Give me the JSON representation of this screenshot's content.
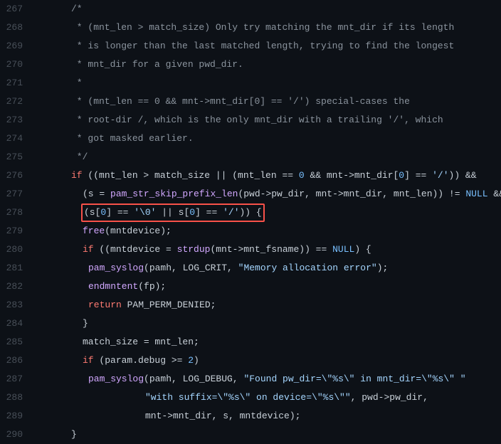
{
  "lines": [
    {
      "num": "267",
      "cls": "indent1",
      "segs": [
        {
          "c": "c-comment",
          "t": "/*"
        }
      ]
    },
    {
      "num": "268",
      "cls": "indent1",
      "segs": [
        {
          "c": "c-comment",
          "t": " * (mnt_len > match_size) Only try matching the mnt_dir if its length"
        }
      ]
    },
    {
      "num": "269",
      "cls": "indent1",
      "segs": [
        {
          "c": "c-comment",
          "t": " * is longer than the last matched length, trying to find the longest"
        }
      ]
    },
    {
      "num": "270",
      "cls": "indent1",
      "segs": [
        {
          "c": "c-comment",
          "t": " * mnt_dir for a given pwd_dir."
        }
      ]
    },
    {
      "num": "271",
      "cls": "indent1",
      "segs": [
        {
          "c": "c-comment",
          "t": " *"
        }
      ]
    },
    {
      "num": "272",
      "cls": "indent1",
      "segs": [
        {
          "c": "c-comment",
          "t": " * (mnt_len == 0 && mnt->mnt_dir[0] == '/') special-cases the"
        }
      ]
    },
    {
      "num": "273",
      "cls": "indent1",
      "segs": [
        {
          "c": "c-comment",
          "t": " * root-dir /, which is the only mnt_dir with a trailing '/', which"
        }
      ]
    },
    {
      "num": "274",
      "cls": "indent1",
      "segs": [
        {
          "c": "c-comment",
          "t": " * got masked earlier."
        }
      ]
    },
    {
      "num": "275",
      "cls": "indent1",
      "segs": [
        {
          "c": "c-comment",
          "t": " */"
        }
      ]
    },
    {
      "num": "276",
      "cls": "indent1",
      "segs": [
        {
          "c": "c-kw",
          "t": "if"
        },
        {
          "c": "c-default",
          "t": " ((mnt_len > match_size || (mnt_len == "
        },
        {
          "c": "c-num",
          "t": "0"
        },
        {
          "c": "c-default",
          "t": " && mnt->mnt_dir["
        },
        {
          "c": "c-num",
          "t": "0"
        },
        {
          "c": "c-default",
          "t": "] == "
        },
        {
          "c": "c-str",
          "t": "'/'"
        },
        {
          "c": "c-default",
          "t": ")) &&"
        }
      ]
    },
    {
      "num": "277",
      "cls": "indent2b",
      "segs": [
        {
          "c": "c-default",
          "t": "(s = "
        },
        {
          "c": "c-fn",
          "t": "pam_str_skip_prefix_len"
        },
        {
          "c": "c-default",
          "t": "(pwd->pw_dir, mnt->mnt_dir, mnt_len)) != "
        },
        {
          "c": "c-const",
          "t": "NULL"
        },
        {
          "c": "c-default",
          "t": " &&"
        }
      ]
    },
    {
      "num": "278",
      "cls": "indent2b",
      "hl": true,
      "segs": [
        {
          "c": "c-default",
          "t": "(s["
        },
        {
          "c": "c-num",
          "t": "0"
        },
        {
          "c": "c-default",
          "t": "] == "
        },
        {
          "c": "c-str",
          "t": "'\\0'"
        },
        {
          "c": "c-default",
          "t": " || s["
        },
        {
          "c": "c-num",
          "t": "0"
        },
        {
          "c": "c-default",
          "t": "] == "
        },
        {
          "c": "c-str",
          "t": "'/'"
        },
        {
          "c": "c-default",
          "t": ")) {"
        }
      ]
    },
    {
      "num": "279",
      "cls": "indent2b",
      "segs": [
        {
          "c": "c-fn",
          "t": "free"
        },
        {
          "c": "c-default",
          "t": "(mntdevice);"
        }
      ]
    },
    {
      "num": "280",
      "cls": "indent2b",
      "segs": [
        {
          "c": "c-kw",
          "t": "if"
        },
        {
          "c": "c-default",
          "t": " ((mntdevice = "
        },
        {
          "c": "c-fn",
          "t": "strdup"
        },
        {
          "c": "c-default",
          "t": "(mnt->mnt_fsname)) == "
        },
        {
          "c": "c-const",
          "t": "NULL"
        },
        {
          "c": "c-default",
          "t": ") {"
        }
      ]
    },
    {
      "num": "281",
      "cls": "indent3",
      "segs": [
        {
          "c": "c-fn",
          "t": "pam_syslog"
        },
        {
          "c": "c-default",
          "t": "(pamh, LOG_CRIT, "
        },
        {
          "c": "c-str",
          "t": "\"Memory allocation error\""
        },
        {
          "c": "c-default",
          "t": ");"
        }
      ]
    },
    {
      "num": "282",
      "cls": "indent3",
      "segs": [
        {
          "c": "c-fn",
          "t": "endmntent"
        },
        {
          "c": "c-default",
          "t": "(fp);"
        }
      ]
    },
    {
      "num": "283",
      "cls": "indent3",
      "segs": [
        {
          "c": "c-kw",
          "t": "return"
        },
        {
          "c": "c-default",
          "t": " PAM_PERM_DENIED;"
        }
      ]
    },
    {
      "num": "284",
      "cls": "indent2b",
      "segs": [
        {
          "c": "c-default",
          "t": "}"
        }
      ]
    },
    {
      "num": "285",
      "cls": "indent2b",
      "segs": [
        {
          "c": "c-default",
          "t": "match_size = mnt_len;"
        }
      ]
    },
    {
      "num": "286",
      "cls": "indent2b",
      "segs": [
        {
          "c": "c-kw",
          "t": "if"
        },
        {
          "c": "c-default",
          "t": " (param.debug >= "
        },
        {
          "c": "c-num",
          "t": "2"
        },
        {
          "c": "c-default",
          "t": ")"
        }
      ]
    },
    {
      "num": "287",
      "cls": "indent3",
      "segs": [
        {
          "c": "c-fn",
          "t": "pam_syslog"
        },
        {
          "c": "c-default",
          "t": "(pamh, LOG_DEBUG, "
        },
        {
          "c": "c-str",
          "t": "\"Found pw_dir=\\\"%s\\\" in mnt_dir=\\\"%s\\\" \""
        }
      ]
    },
    {
      "num": "288",
      "cls": "indentDeep",
      "segs": [
        {
          "c": "c-str",
          "t": "\"with suffix=\\\"%s\\\" on device=\\\"%s\\\"\""
        },
        {
          "c": "c-default",
          "t": ", pwd->pw_dir,"
        }
      ]
    },
    {
      "num": "289",
      "cls": "indentDeep",
      "segs": [
        {
          "c": "c-default",
          "t": "mnt->mnt_dir, s, mntdevice);"
        }
      ]
    },
    {
      "num": "290",
      "cls": "indent1",
      "segs": [
        {
          "c": "c-default",
          "t": "}"
        }
      ]
    }
  ]
}
